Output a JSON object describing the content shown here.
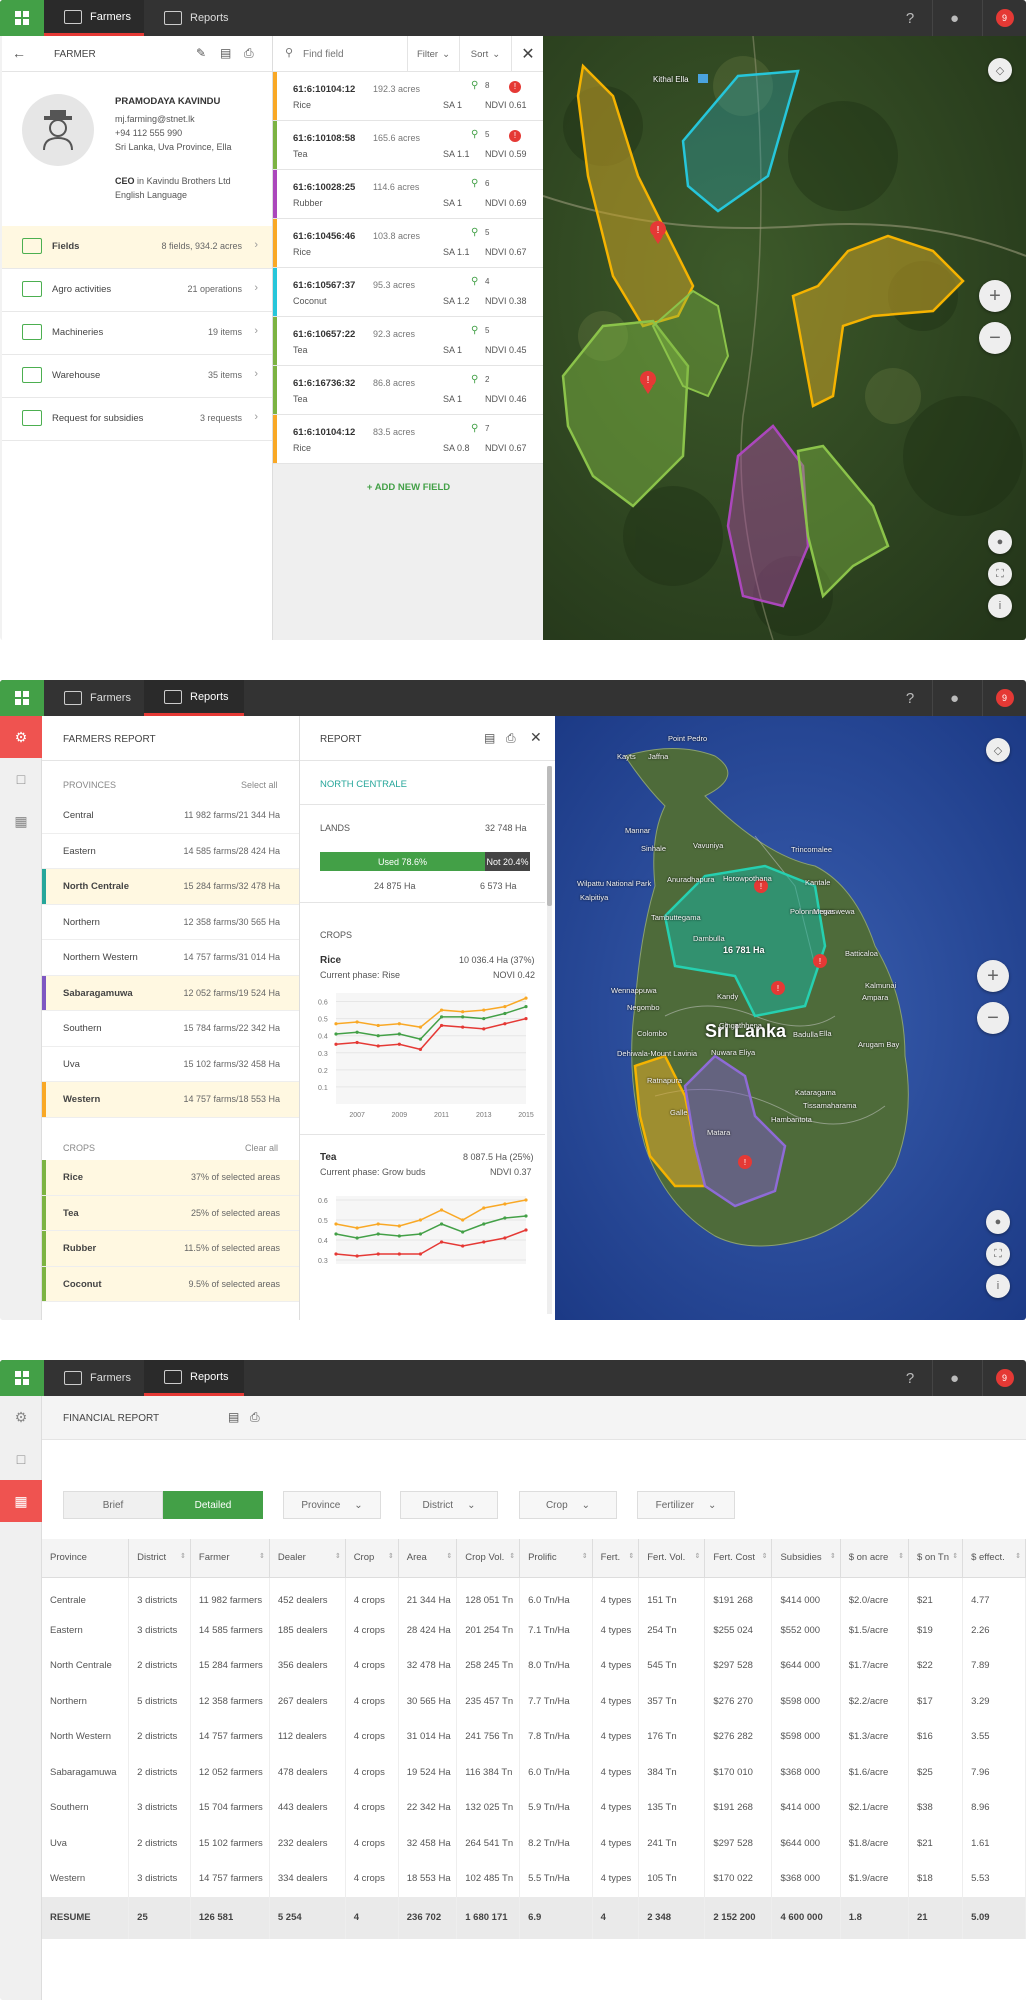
{
  "nav": {
    "farmers": "Farmers",
    "reports": "Reports",
    "badge": "9",
    "help": "?"
  },
  "farmer": {
    "header": "FARMER",
    "name": "PRAMODAYA KAVINDU",
    "email": "mj.farming@stnet.lk",
    "phone": "+94 112 555 990",
    "address": "Sri Lanka, Uva Province, Ella",
    "role_title": "CEO",
    "role_in": "in",
    "company": "Kavindu Brothers Ltd",
    "language": "English Language",
    "menu": [
      {
        "label": "Fields",
        "value": "8 fields, 934.2 acres"
      },
      {
        "label": "Agro activities",
        "value": "21 operations"
      },
      {
        "label": "Machineries",
        "value": "19 items"
      },
      {
        "label": "Warehouse",
        "value": "35 items"
      },
      {
        "label": "Request for subsidies",
        "value": "3 requests"
      }
    ]
  },
  "fields": {
    "search_placeholder": "Find field",
    "filter": "Filter",
    "sort": "Sort",
    "add": "ADD NEW FIELD",
    "items": [
      {
        "id": "61:6:10104:12",
        "acres": "192.3 acres",
        "crop": "Rice",
        "sa": "SA 1",
        "ndvi": "NDVI 0.61",
        "count": "8",
        "alert": "!",
        "color": "#f9a825"
      },
      {
        "id": "61:6:10108:58",
        "acres": "165.6 acres",
        "crop": "Tea",
        "sa": "SA 1.1",
        "ndvi": "NDVI 0.59",
        "count": "5",
        "alert": "!",
        "color": "#7cb342"
      },
      {
        "id": "61:6:10028:25",
        "acres": "114.6 acres",
        "crop": "Rubber",
        "sa": "SA 1",
        "ndvi": "NDVI 0.69",
        "count": "6",
        "alert": "",
        "color": "#ab47bc"
      },
      {
        "id": "61:6:10456:46",
        "acres": "103.8 acres",
        "crop": "Rice",
        "sa": "SA 1.1",
        "ndvi": "NDVI 0.67",
        "count": "5",
        "alert": "",
        "color": "#f9a825"
      },
      {
        "id": "61:6:10567:37",
        "acres": "95.3 acres",
        "crop": "Coconut",
        "sa": "SA 1.2",
        "ndvi": "NDVI 0.38",
        "count": "4",
        "alert": "",
        "color": "#26c6da"
      },
      {
        "id": "61:6:10657:22",
        "acres": "92.3 acres",
        "crop": "Tea",
        "sa": "SA 1",
        "ndvi": "NDVI 0.45",
        "count": "5",
        "alert": "",
        "color": "#7cb342"
      },
      {
        "id": "61:6:16736:32",
        "acres": "86.8 acres",
        "crop": "Tea",
        "sa": "SA 1",
        "ndvi": "NDVI 0.46",
        "count": "2",
        "alert": "",
        "color": "#7cb342"
      },
      {
        "id": "61:6:10104:12",
        "acres": "83.5 acres",
        "crop": "Rice",
        "sa": "SA 0.8",
        "ndvi": "NDVI 0.67",
        "count": "7",
        "alert": "",
        "color": "#f9a825"
      }
    ]
  },
  "map1": {
    "place": "Kithal Ella"
  },
  "farmers_report": {
    "title": "FARMERS REPORT",
    "provinces_label": "PROVINCES",
    "select_all": "Select all",
    "crops_label": "CROPS",
    "clear_all": "Clear all",
    "provinces": [
      {
        "name": "Central",
        "value": "11 982 farms/21 344 Ha",
        "sel": false,
        "bar": ""
      },
      {
        "name": "Eastern",
        "value": "14 585 farms/28 424 Ha",
        "sel": false,
        "bar": ""
      },
      {
        "name": "North Centrale",
        "value": "15 284 farms/32 478 Ha",
        "sel": true,
        "bar": "#26a69a"
      },
      {
        "name": "Northern",
        "value": "12 358 farms/30 565 Ha",
        "sel": false,
        "bar": ""
      },
      {
        "name": "Northern Western",
        "value": "14 757 farms/31 014 Ha",
        "sel": false,
        "bar": ""
      },
      {
        "name": "Sabaragamuwa",
        "value": "12 052 farms/19 524 Ha",
        "sel": true,
        "bar": "#7e57c2"
      },
      {
        "name": "Southern",
        "value": "15 784 farms/22 342 Ha",
        "sel": false,
        "bar": ""
      },
      {
        "name": "Uva",
        "value": "15 102 farms/32 458 Ha",
        "sel": false,
        "bar": ""
      },
      {
        "name": "Western",
        "value": "14 757 farms/18 553 Ha",
        "sel": true,
        "bar": "#f9a825"
      }
    ],
    "crops": [
      {
        "name": "Rice",
        "value": "37% of selected areas"
      },
      {
        "name": "Tea",
        "value": "25% of selected areas"
      },
      {
        "name": "Rubber",
        "value": "11.5% of selected areas"
      },
      {
        "name": "Coconut",
        "value": "9.5% of selected areas"
      }
    ]
  },
  "report": {
    "title": "REPORT",
    "region": "NORTH CENTRALE",
    "lands_label": "LANDS",
    "lands_total": "32 748 Ha",
    "used_label": "Used 78.6%",
    "not_label": "Not 20.4%",
    "used_fraction": 0.786,
    "used_ha": "24 875 Ha",
    "not_ha": "6 573 Ha",
    "crops_label": "CROPS",
    "crop1": {
      "name": "Rice",
      "value": "10 036.4 Ha (37%)",
      "phase": "Current phase: Rise",
      "ndvi": "NOVI 0.42"
    },
    "crop2": {
      "name": "Tea",
      "value": "8 087.5 Ha (25%)",
      "phase": "Current phase: Grow buds",
      "ndvi": "NDVI 0.37"
    }
  },
  "chart_data": [
    {
      "type": "line",
      "x": [
        2006,
        2007,
        2008,
        2009,
        2010,
        2011,
        2012,
        2013,
        2014,
        2015
      ],
      "xticks": [
        "2007",
        "2009",
        "2011",
        "2013",
        "2015"
      ],
      "yticks": [
        "0.1",
        "0.2",
        "0.3",
        "0.4",
        "0.5",
        "0.6"
      ],
      "ylim": [
        0,
        0.65
      ],
      "series": [
        {
          "values": [
            0.47,
            0.48,
            0.46,
            0.47,
            0.45,
            0.55,
            0.54,
            0.55,
            0.57,
            0.62
          ],
          "color": "#f9a825"
        },
        {
          "values": [
            0.41,
            0.42,
            0.4,
            0.41,
            0.38,
            0.51,
            0.51,
            0.5,
            0.53,
            0.57
          ],
          "color": "#43a047"
        },
        {
          "values": [
            0.35,
            0.36,
            0.34,
            0.35,
            0.32,
            0.46,
            0.45,
            0.44,
            0.47,
            0.5
          ],
          "color": "#e53935"
        }
      ]
    },
    {
      "type": "line",
      "x": [
        2006,
        2007,
        2008,
        2009,
        2010,
        2011,
        2012,
        2013,
        2014,
        2015
      ],
      "yticks": [
        "0.3",
        "0.4",
        "0.5",
        "0.6"
      ],
      "ylim": [
        0.28,
        0.62
      ],
      "series": [
        {
          "values": [
            0.48,
            0.46,
            0.48,
            0.47,
            0.5,
            0.55,
            0.5,
            0.56,
            0.58,
            0.6
          ],
          "color": "#f9a825"
        },
        {
          "values": [
            0.43,
            0.41,
            0.43,
            0.42,
            0.43,
            0.48,
            0.44,
            0.48,
            0.51,
            0.52
          ],
          "color": "#43a047"
        },
        {
          "values": [
            0.33,
            0.32,
            0.33,
            0.33,
            0.33,
            0.39,
            0.37,
            0.39,
            0.41,
            0.45
          ],
          "color": "#e53935"
        }
      ]
    }
  ],
  "map2": {
    "country": "Sri Lanka",
    "area_label": "16 781 Ha",
    "places": [
      "Point Pedro",
      "Kayts",
      "Jaffna",
      "Mannar",
      "Vavuniya",
      "Trincomalee",
      "Anuradhapura",
      "Wilpattu National Park",
      "Kalpitiya",
      "Polonnaruwa",
      "Batticaloa",
      "Kalmunai",
      "Ampara",
      "Kandy",
      "Nuwara Eliya",
      "Badulla",
      "Colombo",
      "Negombo",
      "Wennappuwa",
      "Dehiwala-Mount Lavinia",
      "Galle",
      "Matara",
      "Hambantota",
      "Tissamaharama",
      "Kataragama",
      "Arugam Bay",
      "Dambulla",
      "Tambuttegama",
      "Sinhale",
      "Horowpothana",
      "Kantale",
      "Megaswewa",
      "Ratnapura",
      "Gingathhena",
      "Ella"
    ]
  },
  "financial": {
    "title": "FINANCIAL REPORT",
    "brief": "Brief",
    "detailed": "Detailed",
    "filters": [
      "Province",
      "District",
      "Crop",
      "Fertilizer"
    ],
    "columns": [
      "Province",
      "District",
      "Farmer",
      "Dealer",
      "Crop",
      "Area",
      "Crop Vol.",
      "Prolific",
      "Fert.",
      "Fert. Vol.",
      "Fert. Cost",
      "Subsidies",
      "$ on acre",
      "$ on Tn",
      "$ effect."
    ],
    "rows": [
      [
        "Centrale",
        "3 districts",
        "11 982 farmers",
        "452 dealers",
        "4 crops",
        "21 344 Ha",
        "128 051 Tn",
        "6.0 Tn/Ha",
        "4 types",
        "151 Tn",
        "$191 268",
        "$414 000",
        "$2.0/acre",
        "$21",
        "4.77"
      ],
      [
        "Eastern",
        "3 districts",
        "14 585 farmers",
        "185 dealers",
        "4 crops",
        "28 424 Ha",
        "201 254 Tn",
        "7.1 Tn/Ha",
        "4 types",
        "254 Tn",
        "$255 024",
        "$552 000",
        "$1.5/acre",
        "$19",
        "2.26"
      ],
      [
        "North Centrale",
        "2 districts",
        "15 284 farmers",
        "356 dealers",
        "4 crops",
        "32 478 Ha",
        "258 245 Tn",
        "8.0 Tn/Ha",
        "4 types",
        "545 Tn",
        "$297 528",
        "$644 000",
        "$1.7/acre",
        "$22",
        "7.89"
      ],
      [
        "Northern",
        "5 districts",
        "12 358 farmers",
        "267 dealers",
        "4 crops",
        "30 565 Ha",
        "235 457 Tn",
        "7.7 Tn/Ha",
        "4 types",
        "357 Tn",
        "$276 270",
        "$598 000",
        "$2.2/acre",
        "$17",
        "3.29"
      ],
      [
        "North Western",
        "2 districts",
        "14 757 farmers",
        "112 dealers",
        "4 crops",
        "31 014 Ha",
        "241 756 Tn",
        "7.8 Tn/Ha",
        "4 types",
        "176 Tn",
        "$276 282",
        "$598 000",
        "$1.3/acre",
        "$16",
        "3.55"
      ],
      [
        "Sabaragamuwa",
        "2 districts",
        "12 052 farmers",
        "478 dealers",
        "4 crops",
        "19 524 Ha",
        "116 384 Tn",
        "6.0 Tn/Ha",
        "4 types",
        "384 Tn",
        "$170 010",
        "$368 000",
        "$1.6/acre",
        "$25",
        "7.96"
      ],
      [
        "Southern",
        "3 districts",
        "15 704 farmers",
        "443 dealers",
        "4 crops",
        "22 342 Ha",
        "132 025 Tn",
        "5.9 Tn/Ha",
        "4 types",
        "135 Tn",
        "$191 268",
        "$414 000",
        "$2.1/acre",
        "$38",
        "8.96"
      ],
      [
        "Uva",
        "2 districts",
        "15 102 farmers",
        "232 dealers",
        "4 crops",
        "32 458 Ha",
        "264 541 Tn",
        "8.2 Tn/Ha",
        "4 types",
        "241 Tn",
        "$297 528",
        "$644 000",
        "$1.8/acre",
        "$21",
        "1.61"
      ],
      [
        "Western",
        "3 districts",
        "14 757 farmers",
        "334 dealers",
        "4 crops",
        "18 553 Ha",
        "102 485 Tn",
        "5.5 Tn/Ha",
        "4 types",
        "105 Tn",
        "$170 022",
        "$368 000",
        "$1.9/acre",
        "$18",
        "5.53"
      ]
    ],
    "resume": [
      "RESUME",
      "25",
      "126 581",
      "5 254",
      "4",
      "236 702",
      "1 680 171",
      "6.9",
      "4",
      "2 348",
      "2 152 200",
      "4 600 000",
      "1.8",
      "21",
      "5.09"
    ]
  }
}
